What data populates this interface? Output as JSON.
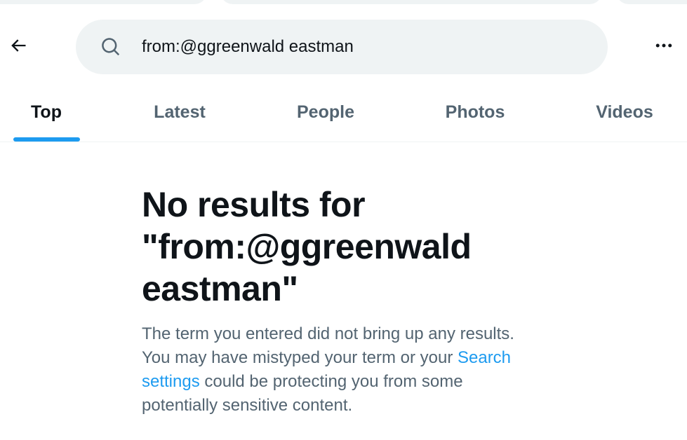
{
  "search": {
    "query": "from:@ggreenwald eastman"
  },
  "icons": {
    "back": "arrow-left-icon",
    "search": "magnifier-icon",
    "more": "ellipsis-horizontal-icon"
  },
  "tabs": [
    {
      "label": "Top",
      "active": true
    },
    {
      "label": "Latest",
      "active": false
    },
    {
      "label": "People",
      "active": false
    },
    {
      "label": "Photos",
      "active": false
    },
    {
      "label": "Videos",
      "active": false
    }
  ],
  "empty_state": {
    "title": "No results for \"from:@ggreenwald eastman\"",
    "body_before": "The term you entered did not bring up any results. You may have mistyped your term or your ",
    "link": "Search settings",
    "body_after": " could be protecting you from some potentially sensitive content."
  },
  "colors": {
    "accent": "#1d9bf0",
    "text_primary": "#0f1419",
    "text_secondary": "#536471",
    "search_bg": "#eff3f4"
  }
}
